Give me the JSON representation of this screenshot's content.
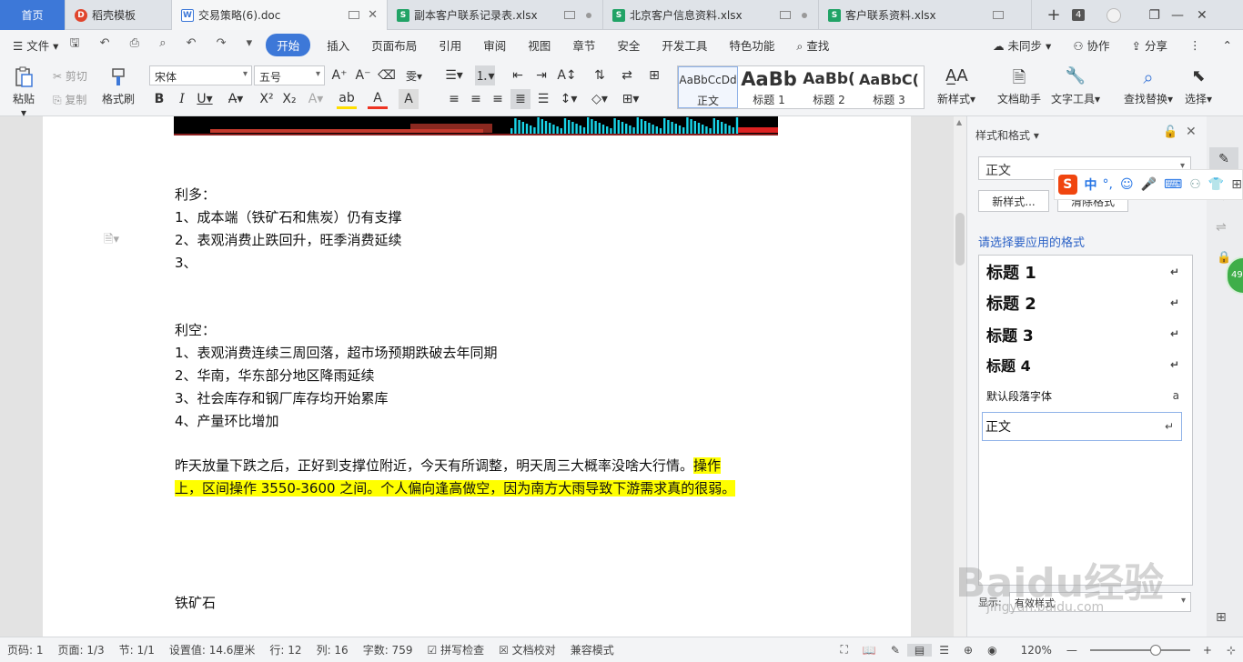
{
  "tabs": {
    "home": "首页",
    "items": [
      {
        "label": "稻壳模板",
        "icon": "daoke-icon"
      },
      {
        "label": "交易策略(6).doc",
        "icon": "word-doc-icon"
      },
      {
        "label": "副本客户联系记录表.xlsx",
        "icon": "spreadsheet-icon"
      },
      {
        "label": "北京客户信息资料.xlsx",
        "icon": "spreadsheet-icon"
      },
      {
        "label": "客户联系资料.xlsx",
        "icon": "spreadsheet-icon"
      }
    ],
    "tab_count": "4"
  },
  "menu": {
    "file": "文件",
    "items": [
      "开始",
      "插入",
      "页面布局",
      "引用",
      "审阅",
      "视图",
      "章节",
      "安全",
      "开发工具",
      "特色功能"
    ],
    "search": "查找",
    "sync": "未同步",
    "collab": "协作",
    "share": "分享"
  },
  "ribbon": {
    "paste": "粘贴",
    "cut": "剪切",
    "copy": "复制",
    "format_painter": "格式刷",
    "font_name": "宋体",
    "font_size": "五号",
    "styles": [
      {
        "preview": "AaBbCcDd",
        "label": "正文"
      },
      {
        "preview": "AaBb",
        "label": "标题 1"
      },
      {
        "preview": "AaBb(",
        "label": "标题 2"
      },
      {
        "preview": "AaBbC(",
        "label": "标题 3"
      }
    ],
    "new_style": "新样式",
    "doc_helper": "文档助手",
    "text_tools": "文字工具",
    "find_replace": "查找替换",
    "select": "选择"
  },
  "document": {
    "lines": [
      "利多：",
      "1、成本端（铁矿石和焦炭）仍有支撑",
      "2、表观消费止跌回升，旺季消费延续",
      "3、",
      "利空：",
      "1、表观消费连续三周回落，超市场预期跌破去年同期",
      "2、华南，华东部分地区降雨延续",
      "3、社会库存和钢厂库存均开始累库",
      "4、产量环比增加"
    ],
    "para1_plain": "昨天放量下跌之后，正好到支撑位附近，今天有所调整，明天周三大概率没啥大行情。",
    "para1_hl1": "操作",
    "para2_hl": "上，区间操作 3550-3600 之间。个人偏向逢高做空，因为南方大雨导致下游需求真的很弱。",
    "iron_ore": "铁矿石"
  },
  "panel": {
    "title": "样式和格式",
    "current_style": "正文",
    "new_style_btn": "新样式...",
    "clear_format_btn": "清除格式",
    "apply_label": "请选择要应用的格式",
    "styles": [
      {
        "label": "标题 1",
        "mark": "↵"
      },
      {
        "label": "标题 2",
        "mark": "↵"
      },
      {
        "label": "标题 3",
        "mark": "↵"
      },
      {
        "label": "标题 4",
        "mark": "↵"
      },
      {
        "label": "默认段落字体",
        "mark": "a"
      },
      {
        "label": "正文",
        "mark": "↵"
      }
    ],
    "show_label": "显示:",
    "show_value": "有效样式"
  },
  "status": {
    "page": "页码: 1",
    "pages": "页面: 1/3",
    "section": "节: 1/1",
    "setting": "设置值: 14.6厘米",
    "row": "行: 12",
    "col": "列: 16",
    "words": "字数: 759",
    "spell": "拼写检查",
    "proof": "文档校对",
    "compat": "兼容模式",
    "zoom": "120%"
  },
  "ime": {
    "zh": "中",
    "punct": "°,"
  },
  "badge": "49",
  "watermark": {
    "main": "Baidu经验",
    "sub": "jingyan.baidu.com"
  },
  "colors": {
    "accent": "#3d78d8",
    "highlight": "#ffff00",
    "excel": "#21a366"
  }
}
